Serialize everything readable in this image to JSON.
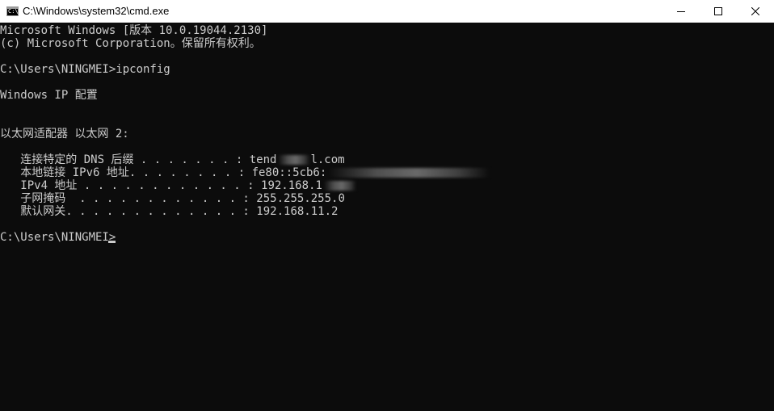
{
  "window": {
    "title": "C:\\Windows\\system32\\cmd.exe",
    "icon": "cmd-app-icon",
    "icon_text": "C:\\",
    "controls": [
      "minimize-icon",
      "maximize-icon",
      "close-icon"
    ]
  },
  "console": {
    "banner_line1": "Microsoft Windows [版本 10.0.19044.2130]",
    "banner_line2": "(c) Microsoft Corporation。保留所有权利。",
    "prompt1": "C:\\Users\\NINGMEI>ipconfig",
    "ip_config_heading": "Windows IP 配置",
    "adapter_heading": "以太网适配器 以太网 2:",
    "rows": [
      {
        "label": "   连接特定的 DNS 后缀 . . . . . . . : ",
        "value": "tend",
        "value_after_redaction": "l.com"
      },
      {
        "label": "   本地链接 IPv6 地址. . . . . . . . : ",
        "value": "fe80::5cb6:",
        "value_after_redaction": ""
      },
      {
        "label": "   IPv4 地址 . . . . . . . . . . . . : ",
        "value": "192.168.1",
        "value_after_redaction": ""
      },
      {
        "label": "   子网掩码  . . . . . . . . . . . . : ",
        "value": "255.255.255.0",
        "value_after_redaction": ""
      },
      {
        "label": "   默认网关. . . . . . . . . . . . . : ",
        "value": "192.168.11.2",
        "value_after_redaction": ""
      }
    ],
    "prompt2": "C:\\Users\\NINGMEI>",
    "colors": {
      "background": "#0c0c0c",
      "text": "#cccccc"
    }
  }
}
